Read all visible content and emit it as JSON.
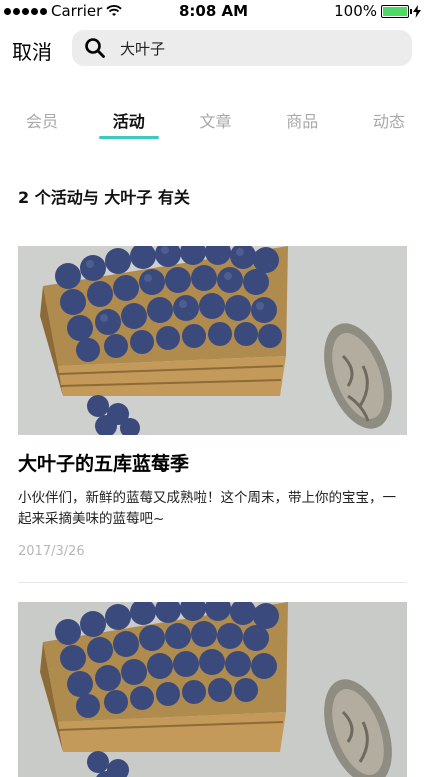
{
  "status_bar": {
    "carrier": "Carrier",
    "time": "8:08 AM",
    "battery": "100%",
    "icons": [
      "signal-icon",
      "wifi-icon",
      "bolt-icon",
      "battery-icon"
    ]
  },
  "search": {
    "cancel_label": "取消",
    "query": "大叶子",
    "icon": "search-icon"
  },
  "tabs": [
    {
      "label": "会员",
      "active": false
    },
    {
      "label": "活动",
      "active": true
    },
    {
      "label": "文章",
      "active": false
    },
    {
      "label": "商品",
      "active": false
    },
    {
      "label": "动态",
      "active": false
    }
  ],
  "results": {
    "summary": "2 个活动与 大叶子 有关"
  },
  "cards": [
    {
      "title": "大叶子的五库蓝莓季",
      "description": "小伙伴们，新鲜的蓝莓又成熟啦！这个周末，带上你的宝宝，一起来采摘美味的蓝莓吧~",
      "date": "2017/3/26"
    },
    {
      "title": "",
      "description": "",
      "date": ""
    }
  ],
  "colors": {
    "accent": "#3ec9c0",
    "battery": "#4cd964",
    "search_bg": "#ececec",
    "tab_inactive": "#a8a8a8",
    "date_text": "#b8b8b8"
  }
}
